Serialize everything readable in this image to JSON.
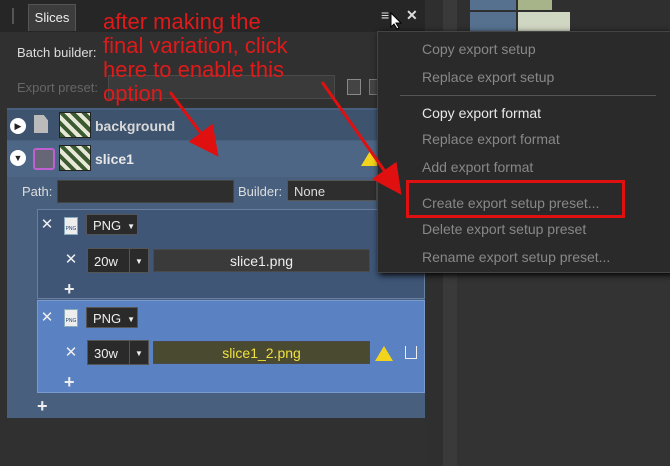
{
  "tab": {
    "label": "Slices"
  },
  "batch_builder": {
    "label": "Batch builder:"
  },
  "export_preset": {
    "label": "Export preset:"
  },
  "slices": [
    {
      "name": "background"
    },
    {
      "name": "slice1"
    }
  ],
  "path": {
    "label": "Path:",
    "value": ""
  },
  "builder": {
    "label": "Builder:",
    "value": "None"
  },
  "variations": [
    {
      "format": "PNG",
      "size": "20w",
      "filename": "slice1.png"
    },
    {
      "format": "PNG",
      "size": "30w",
      "filename": "slice1_2.png"
    }
  ],
  "menu": {
    "items": [
      {
        "label": "Copy export setup",
        "enabled": false
      },
      {
        "label": "Replace export setup",
        "enabled": false
      },
      {
        "label": "Copy export format",
        "enabled": true
      },
      {
        "label": "Replace export format",
        "enabled": false
      },
      {
        "label": "Add export format",
        "enabled": false
      },
      {
        "label": "Create export setup preset...",
        "enabled": false
      },
      {
        "label": "Delete export setup preset",
        "enabled": false
      },
      {
        "label": "Rename export setup preset...",
        "enabled": false
      }
    ]
  },
  "annotation": {
    "text": "after making the\nfinal variation, click\nhere to enable this\noption"
  },
  "colors": {
    "annotation": "#e01a1a",
    "highlight": "#e01010",
    "warning": "#f2d41c",
    "selected_variation": "#5a82c2"
  }
}
